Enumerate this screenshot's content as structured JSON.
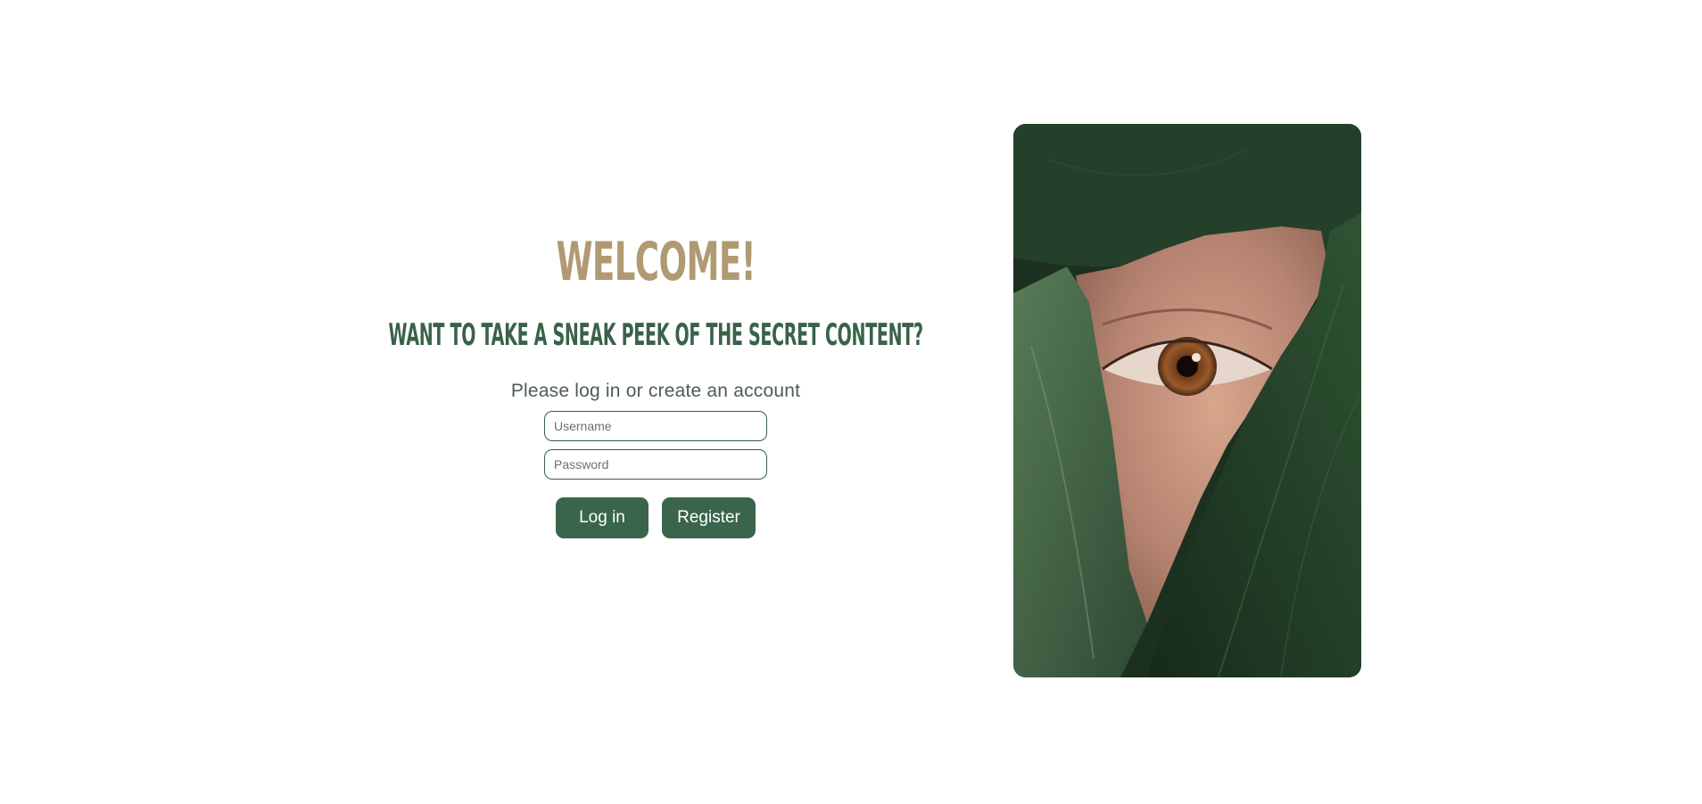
{
  "welcome": {
    "title": "WELCOME!",
    "subtitle": "WANT TO TAKE A SNEAK PEEK OF THE SECRET CONTENT?",
    "prompt": "Please log in or create an account"
  },
  "form": {
    "username_placeholder": "Username",
    "username_value": "",
    "password_placeholder": "Password",
    "password_value": "",
    "login_label": "Log in",
    "register_label": "Register"
  },
  "image": {
    "alt": "eye peeking through torn leaves"
  },
  "colors": {
    "title": "#b09a72",
    "subtitle": "#396249",
    "button": "#3a654c",
    "leaf_dark": "#1d3322"
  }
}
